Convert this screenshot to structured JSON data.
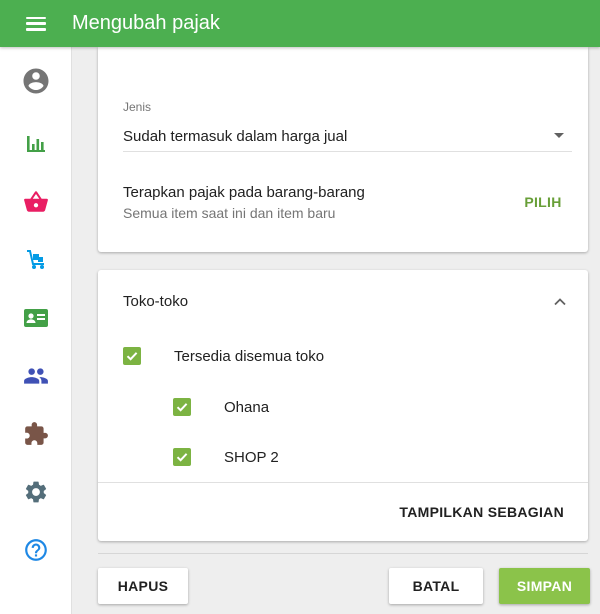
{
  "header": {
    "title": "Mengubah pajak",
    "menu_icon": "hamburger-menu-icon",
    "color": "#4caf50"
  },
  "sidebar": {
    "items": [
      {
        "icon": "account-circle-icon",
        "color": "#757575"
      },
      {
        "icon": "bar-chart-icon",
        "color": "#43a047"
      },
      {
        "icon": "shopping-basket-icon",
        "color": "#e91e63"
      },
      {
        "icon": "hand-truck-icon",
        "color": "#039be5"
      },
      {
        "icon": "contact-card-icon",
        "color": "#43a047"
      },
      {
        "icon": "people-icon",
        "color": "#3f51b5"
      },
      {
        "icon": "puzzle-piece-icon",
        "color": "#795548"
      },
      {
        "icon": "settings-gear-icon",
        "color": "#546e7a"
      },
      {
        "icon": "help-circle-icon",
        "color": "#1e88e5"
      }
    ]
  },
  "tax_form": {
    "type_label": "Jenis",
    "type_value": "Sudah termasuk dalam harga jual",
    "apply_title": "Terapkan pajak pada barang-barang",
    "apply_subtitle": "Semua item saat ini dan item baru",
    "pilih_label": "PILIH"
  },
  "stores": {
    "title": "Toko-toko",
    "all_label": "Tersedia disemua toko",
    "all_checked": true,
    "list": [
      {
        "name": "Ohana",
        "checked": true
      },
      {
        "name": "SHOP 2",
        "checked": true
      }
    ],
    "show_some_label": "TAMPILKAN SEBAGIAN"
  },
  "actions": {
    "delete_label": "HAPUS",
    "cancel_label": "BATAL",
    "save_label": "SIMPAN"
  },
  "colors": {
    "accent": "#4caf50",
    "checkbox": "#7cb342",
    "save_button": "#8bc34a",
    "pilih_text": "#689f38"
  }
}
